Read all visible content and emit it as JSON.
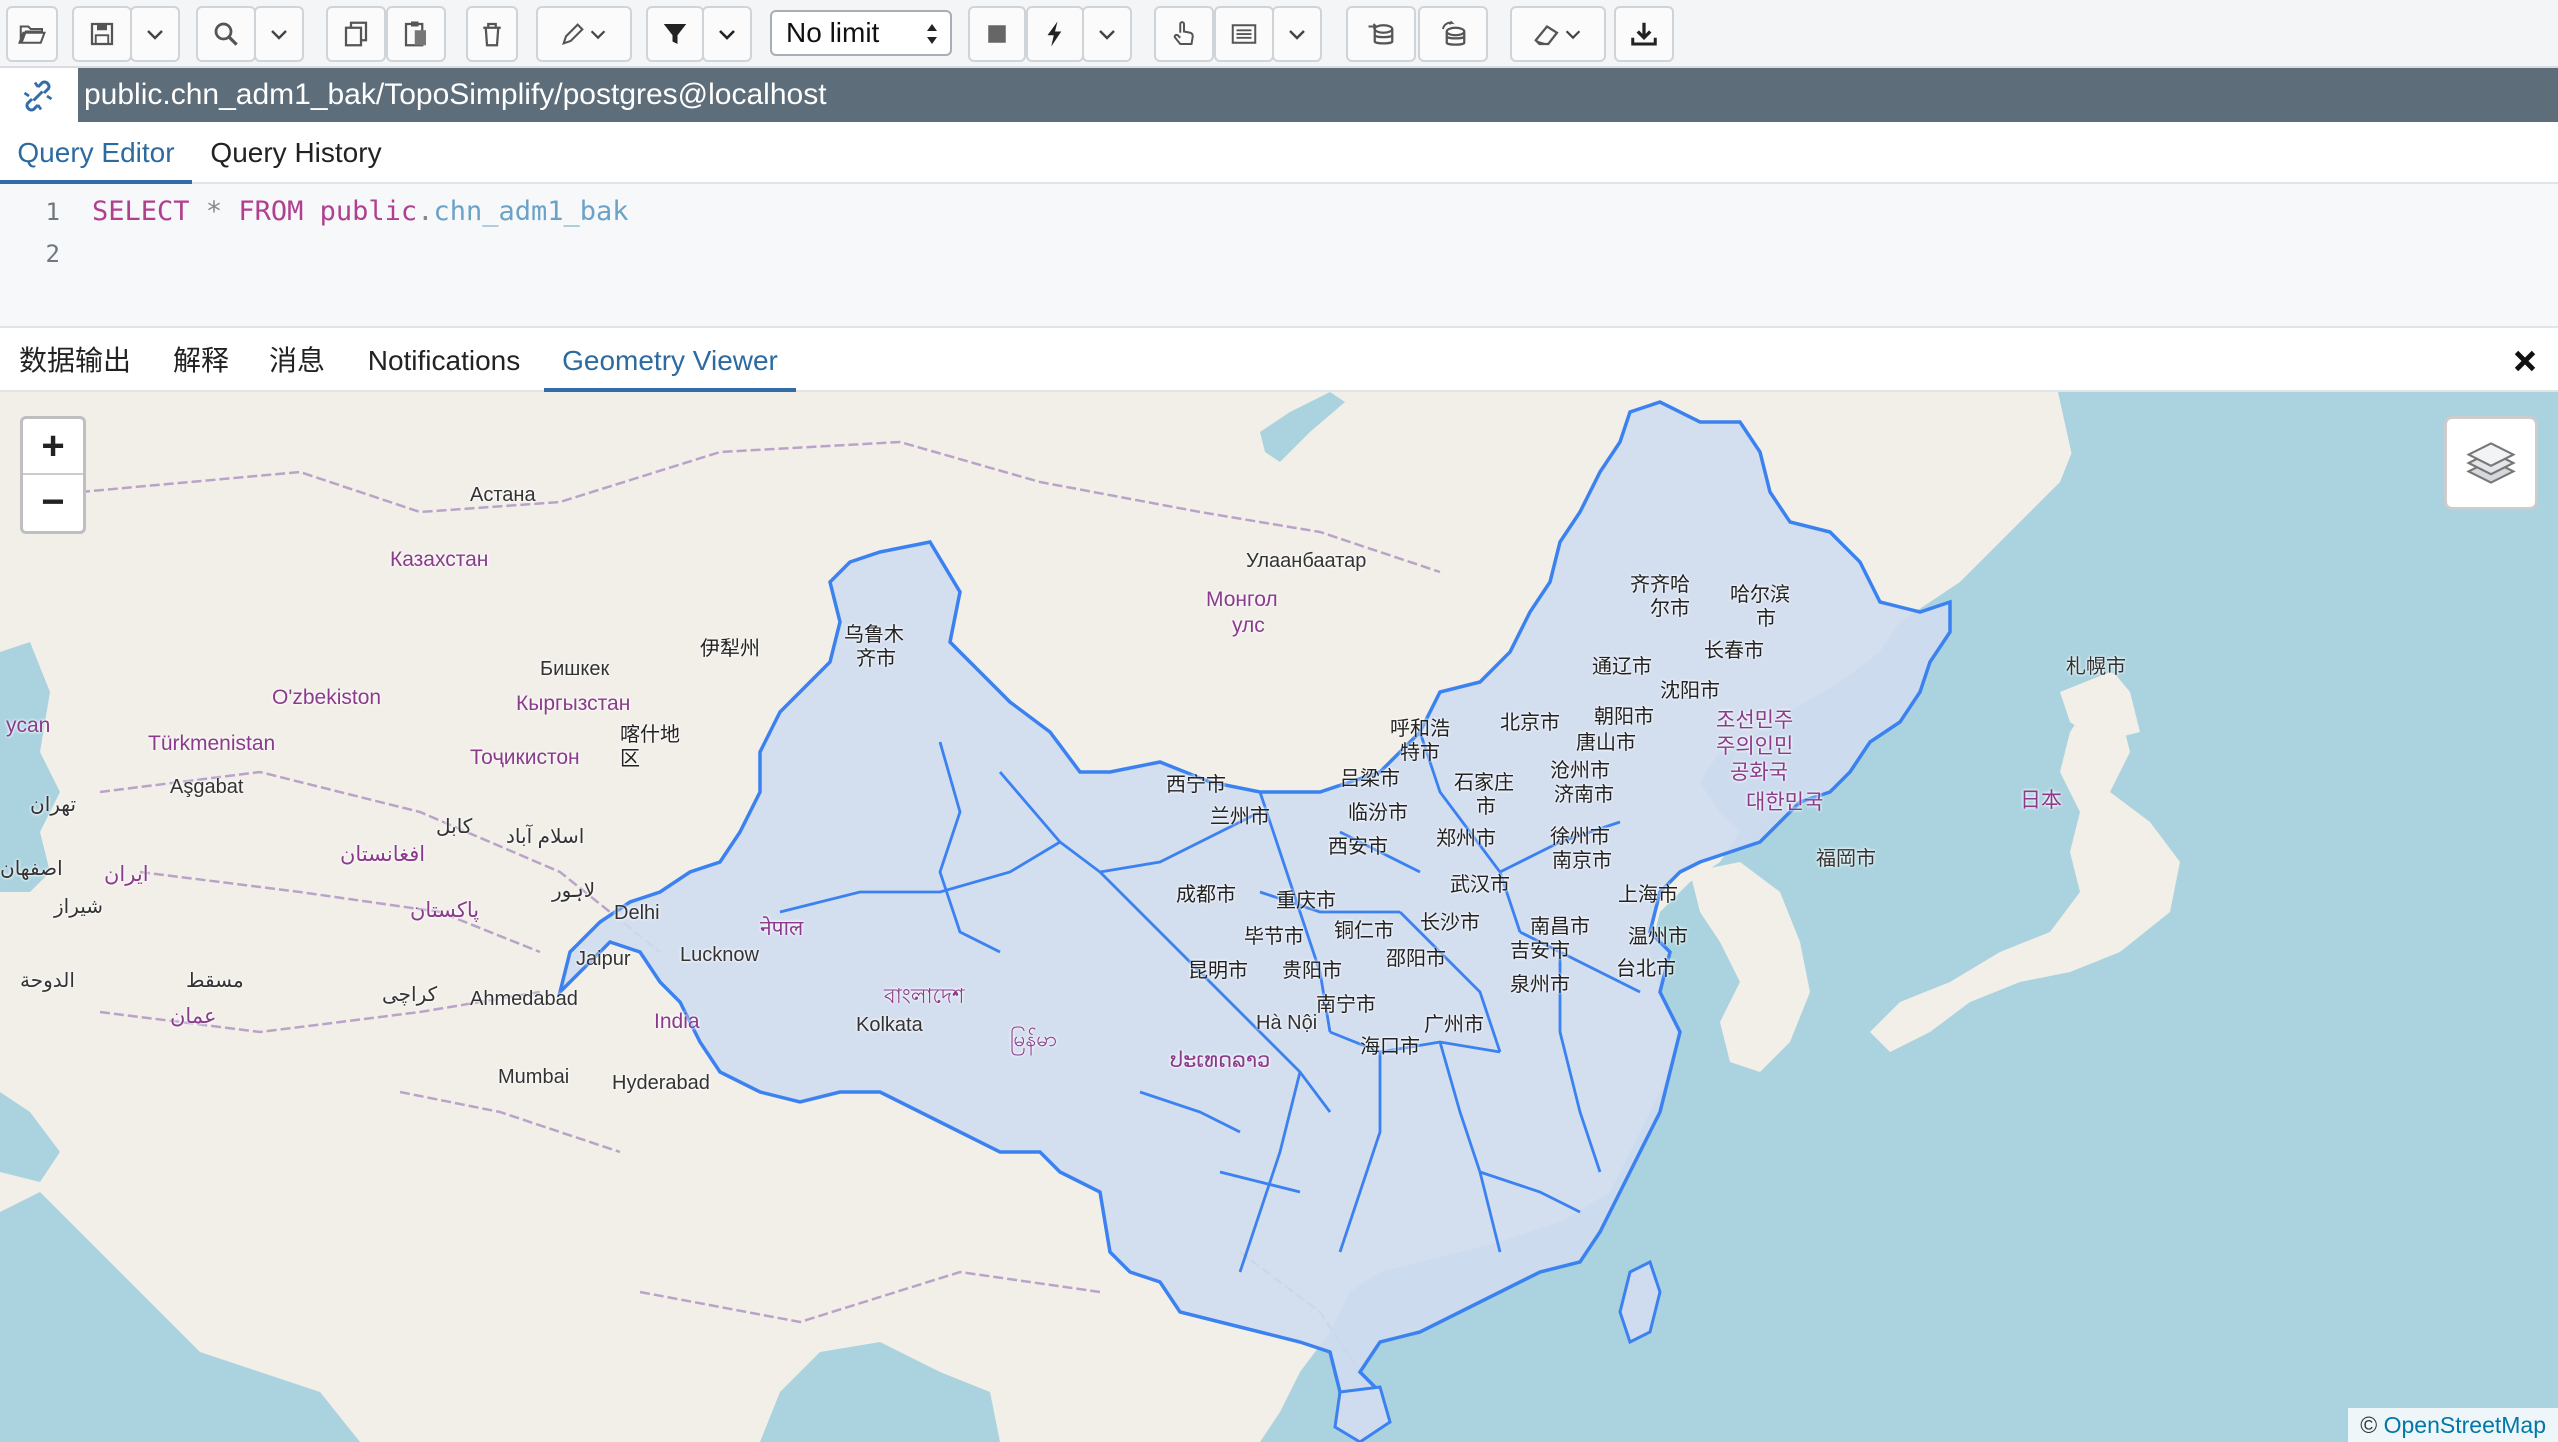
{
  "toolbar": {
    "limit_value": "No limit"
  },
  "connection": {
    "title": "public.chn_adm1_bak/TopoSimplify/postgres@localhost"
  },
  "editor_tabs": [
    {
      "label": "Query Editor"
    },
    {
      "label": "Query History"
    }
  ],
  "editor": {
    "line_numbers": [
      "1",
      "2"
    ],
    "sql": {
      "select": "SELECT",
      "star": "*",
      "from": "FROM",
      "schema": "public",
      "dot": ".",
      "table": "chn_adm1_bak"
    }
  },
  "result_tabs": [
    {
      "label": "数据输出"
    },
    {
      "label": "解释"
    },
    {
      "label": "消息"
    },
    {
      "label": "Notifications"
    },
    {
      "label": "Geometry Viewer"
    }
  ],
  "map": {
    "zoom_in": "+",
    "zoom_out": "−",
    "attribution_prefix": "©",
    "attribution_link": "OpenStreetMap",
    "colors": {
      "water": "#aad3df",
      "land": "#f2efe9",
      "geom_fill": "#cfdcef",
      "geom_stroke": "#3b82f0",
      "border": "#b9a3c8"
    },
    "labels": {
      "astana": "Астана",
      "kazakhstan": "Казахстан",
      "ulaanbaatar": "Улаанбаатар",
      "mongolia1": "Монгол",
      "mongolia2": "улс",
      "bishkek": "Бишкек",
      "kyrgyzstan": "Кыргызстан",
      "uzbekistan": "O'zbekiston",
      "turkmenistan": "Türkmenistan",
      "tajikistan": "Тоҷикистон",
      "ashgabat": "Aşgabat",
      "tehran": "تهران",
      "iran": "ایران",
      "afghanistan": "افغانستان",
      "kabul": "کابل",
      "islamabad": "اسلام آباد",
      "lahore": "لاہور",
      "pakistan": "پاکستان",
      "shiraz": "شیراز",
      "esfahan": "اصفهان",
      "delhi": "Delhi",
      "nepal": "नेपाल",
      "jaipur": "Jaipur",
      "lucknow": "Lucknow",
      "karachi": "کراچی",
      "ahmedabad": "Ahmedabad",
      "india": "India",
      "bangladesh": "বাংলাদেশ",
      "kolkata": "Kolkata",
      "myanmar": "မြန်မာ",
      "mumbai": "Mumbai",
      "hyderabad": "Hyderabad",
      "lao": "ປະເທດລາວ",
      "hanoi": "Hà Nội",
      "doha": "الدوحة",
      "muscat": "مسقط",
      "oman": "عمان",
      "baku": "ycan",
      "sapporo": "札幌市",
      "japan": "日本",
      "fukuoka": "福岡市",
      "dprk1": "조선민주",
      "dprk2": "주의인민",
      "dprk3": "공화국",
      "korea": "대한민국",
      "urumqi1": "乌鲁木",
      "urumqi2": "齐市",
      "yili": "伊犁州",
      "kashgar1": "喀什地",
      "kashgar2": "区",
      "qiqihar1": "齐齐哈",
      "qiqihar2": "尔市",
      "harbin1": "哈尔滨",
      "harbin2": "市",
      "changchun": "长春市",
      "tongliao": "通辽市",
      "shenyang": "沈阳市",
      "chaoyang": "朝阳市",
      "beijing": "北京市",
      "tangshan": "唐山市",
      "hohhot1": "呼和浩",
      "hohhot2": "特市",
      "cangzhou": "沧州市",
      "jinan": "济南市",
      "shijiazhuang1": "石家庄",
      "shijiazhuang2": "市",
      "lvliang": "吕梁市",
      "linfen": "临汾市",
      "xining": "西宁市",
      "lanzhou": "兰州市",
      "xian": "西安市",
      "zhengzhou": "郑州市",
      "xuzhou": "徐州市",
      "nanjing": "南京市",
      "shanghai": "上海市",
      "wuhan": "武汉市",
      "chengdu": "成都市",
      "chongqing": "重庆市",
      "tongren": "铜仁市",
      "changsha": "长沙市",
      "nanchang": "南昌市",
      "wenzhou": "温州市",
      "bijie": "毕节市",
      "shaoyang": "邵阳市",
      "jian": "吉安市",
      "kunming": "昆明市",
      "guiyang": "贵阳市",
      "quanzhou": "泉州市",
      "taibei": "台北市",
      "nanning": "南宁市",
      "guangzhou": "广州市",
      "haikou": "海口市"
    }
  }
}
